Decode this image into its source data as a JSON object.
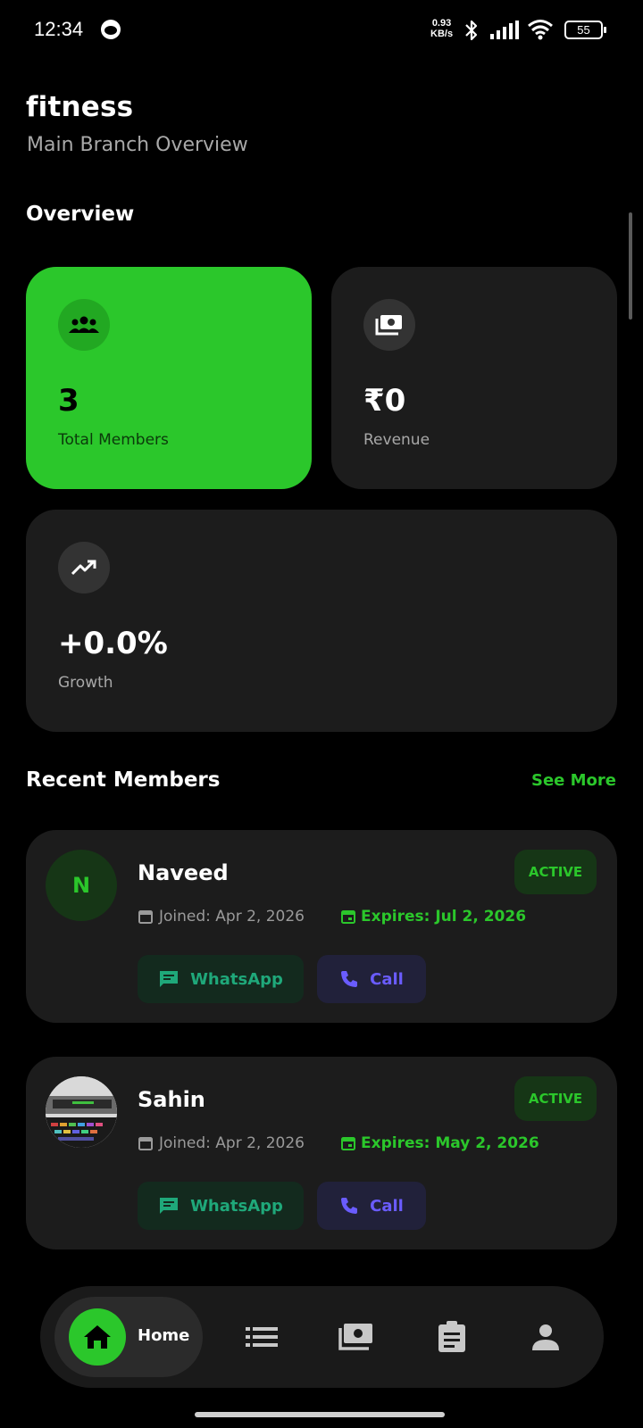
{
  "status_bar": {
    "time": "12:34",
    "speed_value": "0.93",
    "speed_unit": "KB/s",
    "battery": "55"
  },
  "header": {
    "title": "fitness",
    "subtitle": "Main Branch Overview"
  },
  "overview": {
    "title": "Overview",
    "total_members": {
      "value": "3",
      "label": "Total Members",
      "icon": "group-icon"
    },
    "revenue": {
      "value": "₹0",
      "label": "Revenue",
      "icon": "payments-icon"
    },
    "growth": {
      "value": "+0.0%",
      "label": "Growth",
      "icon": "trending-up-icon"
    }
  },
  "recent_members": {
    "title": "Recent Members",
    "see_more": "See More",
    "members": [
      {
        "initial": "N",
        "name": "Naveed",
        "status": "ACTIVE",
        "joined": "Joined: Apr 2, 2026",
        "expires": "Expires: Jul 2, 2026",
        "whatsapp_label": "WhatsApp",
        "call_label": "Call"
      },
      {
        "initial": "",
        "name": "Sahin",
        "status": "ACTIVE",
        "joined": "Joined: Apr 2, 2026",
        "expires": "Expires: May 2, 2026",
        "whatsapp_label": "WhatsApp",
        "call_label": "Call"
      }
    ]
  },
  "bottom_nav": {
    "home_label": "Home",
    "items": [
      "home-icon",
      "list-icon",
      "payments-icon",
      "clipboard-icon",
      "person-icon"
    ]
  },
  "colors": {
    "accent": "#2bc72b",
    "card": "#1c1c1c",
    "background": "#000000",
    "whatsapp": "#1fa87a",
    "call": "#6a5cff"
  }
}
